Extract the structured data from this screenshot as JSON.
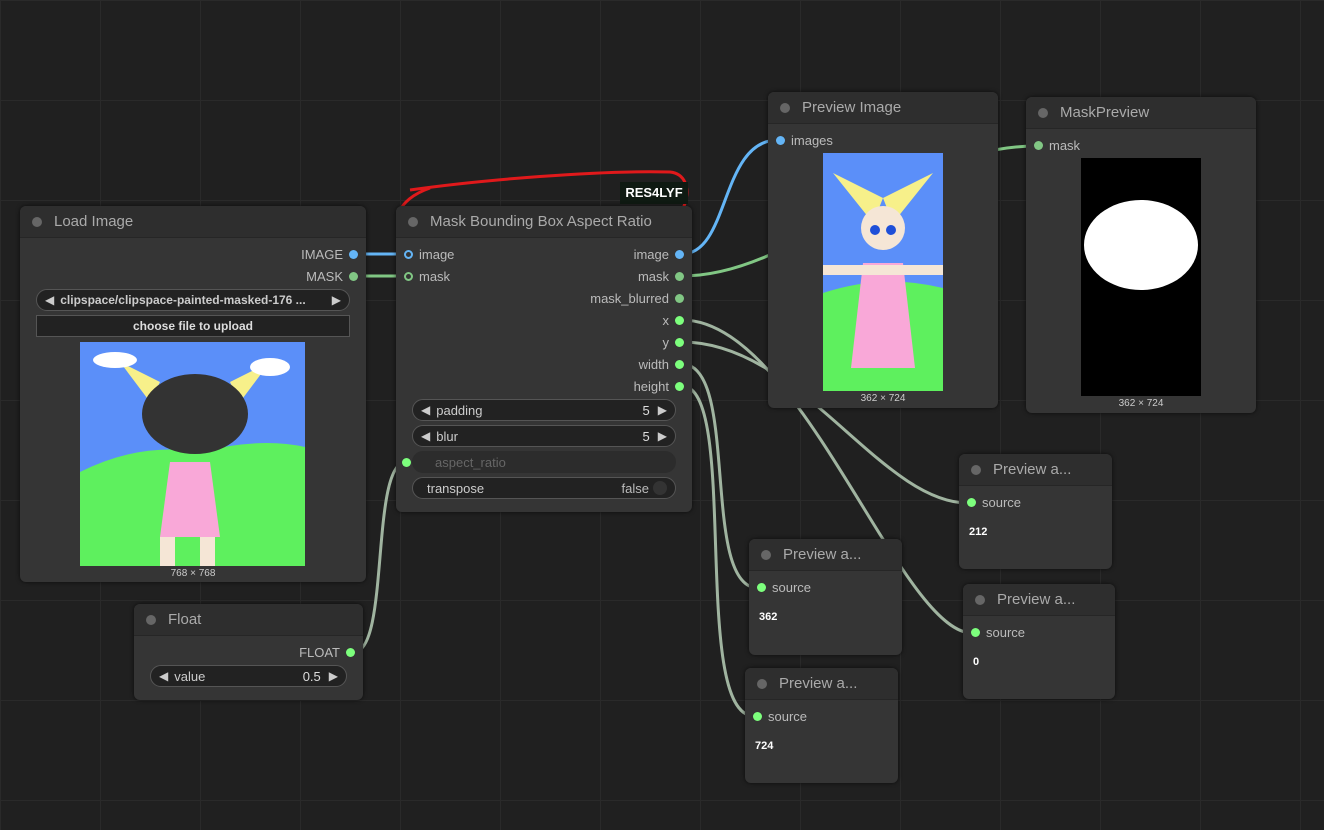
{
  "nodes": {
    "load_image": {
      "title": "Load Image",
      "outputs": [
        "IMAGE",
        "MASK"
      ],
      "file": "clipspace/clipspace-painted-masked-176 ...",
      "upload": "choose file to upload",
      "dims": "768 × 768"
    },
    "mask_bbox": {
      "title": "Mask Bounding Box Aspect Ratio",
      "badge": "RES4LYF",
      "inputs": [
        "image",
        "mask"
      ],
      "outputs": [
        "image",
        "mask",
        "mask_blurred",
        "x",
        "y",
        "width",
        "height"
      ],
      "padding": {
        "label": "padding",
        "value": "5"
      },
      "blur": {
        "label": "blur",
        "value": "5"
      },
      "aspect_ratio": "aspect_ratio",
      "transpose": {
        "label": "transpose",
        "value": "false"
      }
    },
    "preview_image": {
      "title": "Preview Image",
      "input": "images",
      "dims": "362 × 724"
    },
    "mask_preview": {
      "title": "MaskPreview",
      "input": "mask",
      "dims": "362 × 724"
    },
    "float": {
      "title": "Float",
      "output": "FLOAT",
      "label": "value",
      "value": "0.5"
    },
    "preview_y": {
      "title": "Preview a...",
      "input": "source",
      "value": "212"
    },
    "preview_width": {
      "title": "Preview a...",
      "input": "source",
      "value": "362"
    },
    "preview_x": {
      "title": "Preview a...",
      "input": "source",
      "value": "0"
    },
    "preview_height": {
      "title": "Preview a...",
      "input": "source",
      "value": "724"
    }
  },
  "colors": {
    "image": "#64b5f6",
    "mask": "#81c784",
    "number": "#7dff7d",
    "annotation": "#e0191b"
  }
}
